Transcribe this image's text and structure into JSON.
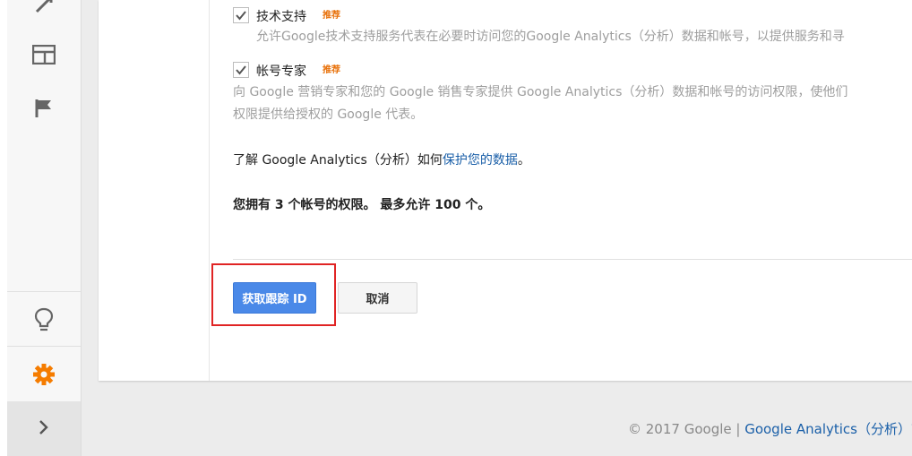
{
  "options": [
    {
      "title": "技术支持",
      "badge": "推荐",
      "checked": true,
      "desc_lines": [
        "允许Google技术支持服务代表在必要时访问您的Google Analytics（分析）数据和帐号，以提供服务和寻"
      ]
    },
    {
      "title": "帐号专家",
      "badge": "推荐",
      "checked": true,
      "desc_lines": [
        "向 Google 营销专家和您的 Google 销售专家提供 Google Analytics（分析）数据和帐号的访问权限，使他们",
        "权限提供给授权的 Google 代表。"
      ]
    }
  ],
  "learn": {
    "prefix": "了解 Google Analytics（分析）如何",
    "link": "保护您的数据",
    "suffix": "。"
  },
  "permissions_text": "您拥有 3 个帐号的权限。 最多允许 100 个。",
  "buttons": {
    "get_id": "获取跟踪 ID",
    "cancel": "取消"
  },
  "footer": {
    "copyright": "© 2017 Google | ",
    "link": "Google Analytics（分析）首"
  },
  "sidebar": {
    "icons": [
      "share-icon",
      "layout-icon",
      "flag-icon",
      "lightbulb-icon",
      "gear-icon",
      "chevron-right-icon"
    ]
  },
  "colors": {
    "accent": "#4a89e8",
    "badge": "#e8710a",
    "gear": "#f57c00",
    "link": "#1a5fa8",
    "highlight": "#e02424"
  }
}
